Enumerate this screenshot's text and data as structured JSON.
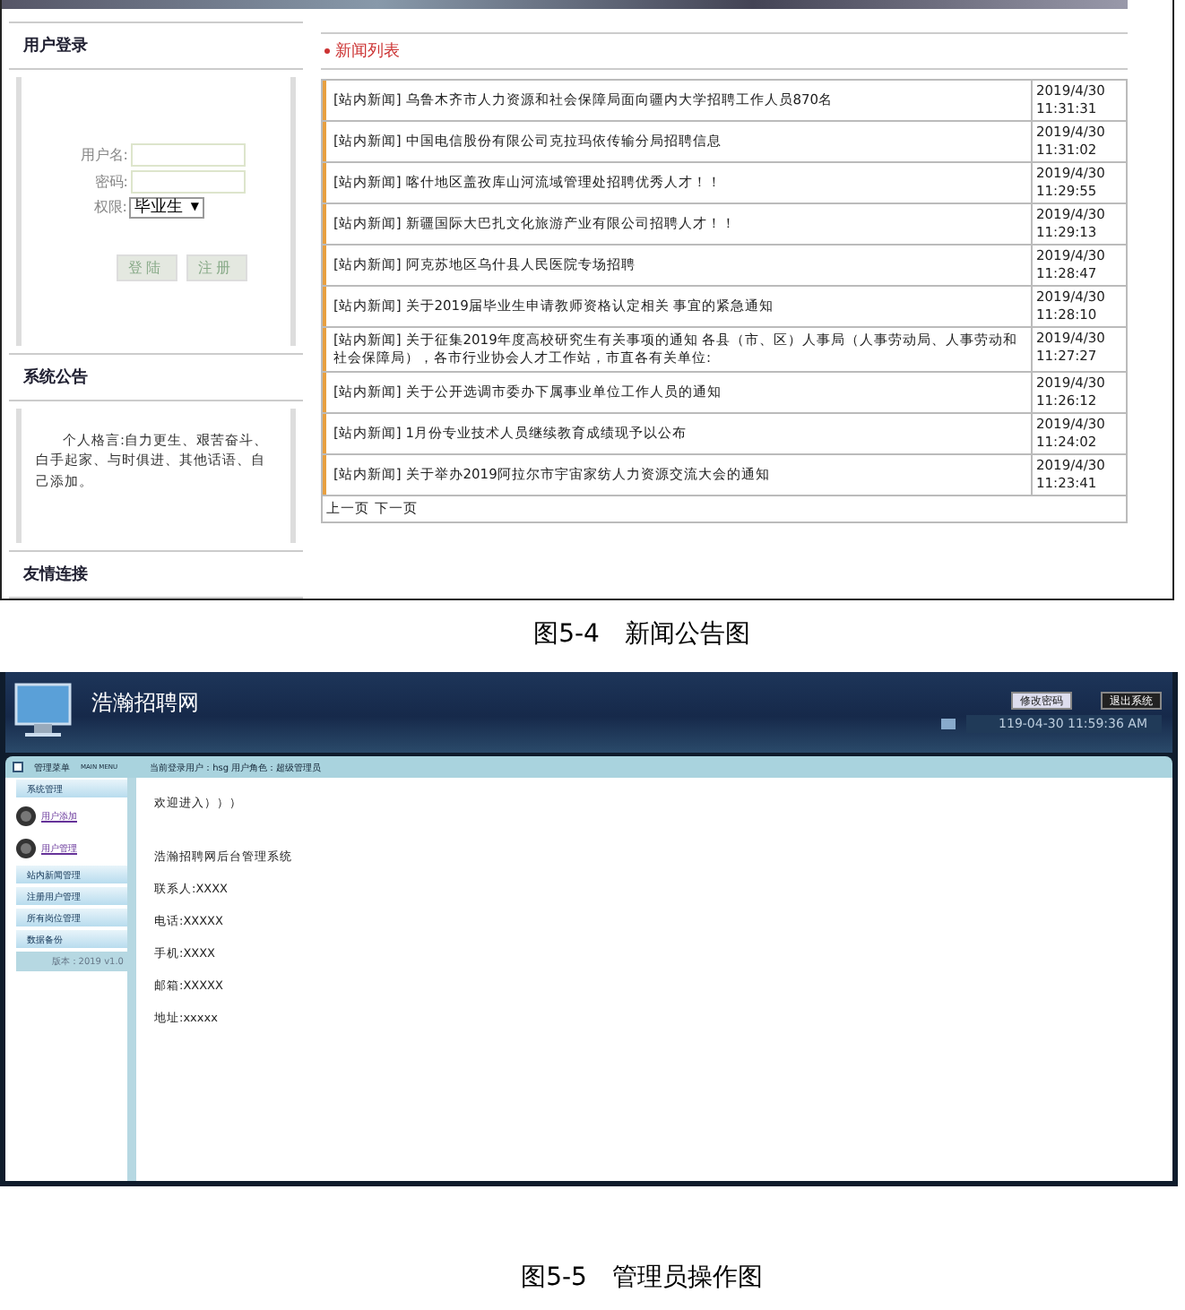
{
  "figure_1": {
    "login": {
      "title": "用户登录",
      "fields": [
        {
          "label": "用户名:"
        },
        {
          "label": "密码:"
        }
      ],
      "role": {
        "label": "权限:",
        "value": "毕业生",
        "caret": "▼"
      },
      "buttons": [
        "登陆",
        "注册"
      ]
    },
    "announcement": {
      "title": "系统公告",
      "text": "个人格言:自力更生、艰苦奋斗、白手起家、与时俱进、其他话语、自己添加。"
    },
    "links": {
      "title": "友情连接"
    },
    "news": {
      "title": "新闻列表",
      "rows": [
        {
          "tag": "[站内新闻]",
          "title": "乌鲁木齐市人力资源和社会保障局面向疆内大学招聘工作人员870名",
          "date": "2019/4/30",
          "time": "11:31:31"
        },
        {
          "tag": "[站内新闻]",
          "title": "中国电信股份有限公司克拉玛依传输分局招聘信息",
          "date": "2019/4/30",
          "time": "11:31:02"
        },
        {
          "tag": "[站内新闻]",
          "title": "喀什地区盖孜库山河流域管理处招聘优秀人才！！",
          "date": "2019/4/30",
          "time": "11:29:55"
        },
        {
          "tag": "[站内新闻]",
          "title": "新疆国际大巴扎文化旅游产业有限公司招聘人才！！",
          "date": "2019/4/30",
          "time": "11:29:13"
        },
        {
          "tag": "[站内新闻]",
          "title": "阿克苏地区乌什县人民医院专场招聘",
          "date": "2019/4/30",
          "time": "11:28:47"
        },
        {
          "tag": "[站内新闻]",
          "title": "关于2019届毕业生申请教师资格认定相关 事宜的紧急通知",
          "date": "2019/4/30",
          "time": "11:28:10"
        },
        {
          "tag": "[站内新闻]",
          "title": "关于征集2019年度高校研究生有关事项的通知 各县（市、区）人事局（人事劳动局、人事劳动和社会保障局），各市行业协会人才工作站，市直各有关单位:",
          "date": "2019/4/30",
          "time": "11:27:27"
        },
        {
          "tag": "[站内新闻]",
          "title": "关于公开选调市委办下属事业单位工作人员的通知",
          "date": "2019/4/30",
          "time": "11:26:12"
        },
        {
          "tag": "[站内新闻]",
          "title": "1月份专业技术人员继续教育成绩现予以公布",
          "date": "2019/4/30",
          "time": "11:24:02"
        },
        {
          "tag": "[站内新闻]",
          "title": "关于举办2019阿拉尔市宇宙家纺人力资源交流大会的通知",
          "date": "2019/4/30",
          "time": "11:23:41"
        }
      ],
      "pager": [
        "上一页",
        "下一页"
      ]
    }
  },
  "caption_1": "图5-4　新闻公告图",
  "figure_2": {
    "header": {
      "title": "浩瀚招聘网",
      "buttons": [
        "修改密码",
        "退出系统"
      ],
      "datetime": "119-04-30 11:59:36 AM"
    },
    "menu_bar": {
      "title": "管理菜单",
      "subtitle": "MAIN MENU",
      "user_info": "当前登录用户：hsg 用户角色：超级管理员"
    },
    "sidebar": {
      "items": [
        {
          "kind": "header",
          "label": "系统管理"
        },
        {
          "kind": "link",
          "label": "用户添加"
        },
        {
          "kind": "link",
          "label": "用户管理"
        },
        {
          "kind": "header",
          "label": "站内新闻管理"
        },
        {
          "kind": "header",
          "label": "注册用户管理"
        },
        {
          "kind": "header",
          "label": "所有岗位管理"
        },
        {
          "kind": "header",
          "label": "数据备份"
        }
      ],
      "version": "版本：2019 v1.0"
    },
    "content": {
      "welcome": "欢迎进入）））",
      "lines": [
        "浩瀚招聘网后台管理系统",
        "联系人:XXXX",
        "电话:XXXXX",
        "手机:XXXX",
        "邮箱:XXXXX",
        "地址:xxxxx"
      ]
    }
  },
  "caption_2": "图5-5　管理员操作图"
}
